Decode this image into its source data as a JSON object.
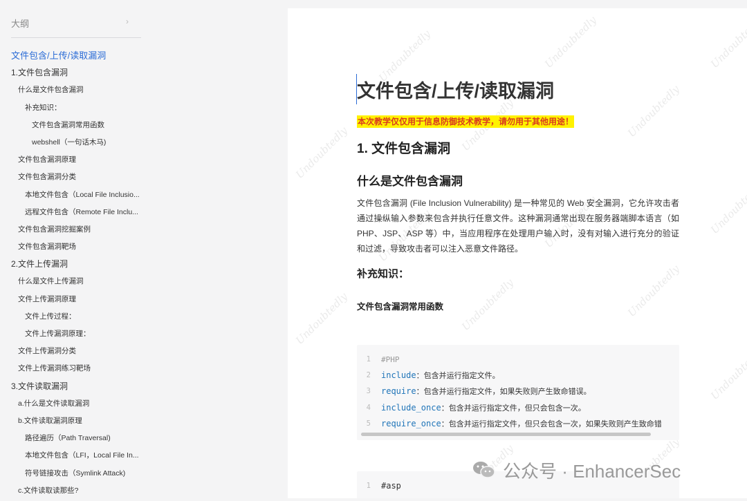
{
  "sidebar": {
    "title": "大纲",
    "collapse_icon": "chevron-right-icon",
    "items": [
      {
        "label": "文件包含/上传/读取漏洞",
        "level": 0
      },
      {
        "label": "1.文件包含漏洞",
        "level": 1
      },
      {
        "label": "什么是文件包含漏洞",
        "level": 2
      },
      {
        "label": "补充知识：",
        "level": 3
      },
      {
        "label": "文件包含漏洞常用函数",
        "level": 4
      },
      {
        "label": "webshell（一句话木马)",
        "level": 4
      },
      {
        "label": "文件包含漏洞原理",
        "level": 2
      },
      {
        "label": "文件包含漏洞分类",
        "level": 2
      },
      {
        "label": "本地文件包含（Local File Inclusio...",
        "level": 3
      },
      {
        "label": "远程文件包含（Remote File Inclu...",
        "level": 3
      },
      {
        "label": "文件包含漏洞挖掘案例",
        "level": 2
      },
      {
        "label": "文件包含漏洞靶场",
        "level": 2
      },
      {
        "label": "2.文件上传漏洞",
        "level": 1
      },
      {
        "label": "什么是文件上传漏洞",
        "level": 2
      },
      {
        "label": "文件上传漏洞原理",
        "level": 2
      },
      {
        "label": "文件上传过程：",
        "level": 3
      },
      {
        "label": "文件上传漏洞原理：",
        "level": 3
      },
      {
        "label": "文件上传漏洞分类",
        "level": 2
      },
      {
        "label": "文件上传漏洞练习靶场",
        "level": 2
      },
      {
        "label": "3.文件读取漏洞",
        "level": 1
      },
      {
        "label": "a.什么是文件读取漏洞",
        "level": 2
      },
      {
        "label": "b.文件读取漏洞原理",
        "level": 2
      },
      {
        "label": "路径遍历（Path Traversal)",
        "level": 3
      },
      {
        "label": "本地文件包含（LFI，Local File In...",
        "level": 3
      },
      {
        "label": "符号链接攻击（Symlink Attack)",
        "level": 3
      },
      {
        "label": "c.文件读取读那些?",
        "level": 2
      }
    ]
  },
  "document": {
    "title": "文件包含/上传/读取漏洞",
    "warning": "本次教学仅仅用于信息防御技术教学，请勿用于其他用途！",
    "h1": "1. 文件包含漏洞",
    "h2": "什么是文件包含漏洞",
    "paragraph": "文件包含漏洞 (File Inclusion Vulnerability) 是一种常见的 Web 安全漏洞，它允许攻击者通过操纵输入参数来包含并执行任意文件。这种漏洞通常出现在服务器端脚本语言（如 PHP、JSP、ASP 等）中，当应用程序在处理用户输入时，没有对输入进行充分的验证和过滤，导致攻击者可以注入恶意文件路径。",
    "h3": "补充知识：",
    "h4": "文件包含漏洞常用函数",
    "code_block_1": [
      {
        "n": "1",
        "comment": "#PHP"
      },
      {
        "n": "2",
        "keyword": "include",
        "desc": "：包含并运行指定文件。"
      },
      {
        "n": "3",
        "keyword": "require",
        "desc": "：包含并运行指定文件，如果失败则产生致命错误。"
      },
      {
        "n": "4",
        "keyword": "include_once",
        "desc": "：包含并运行指定文件，但只会包含一次。"
      },
      {
        "n": "5",
        "keyword": "require_once",
        "desc": "：包含并运行指定文件，但只会包含一次，如果失败则产生致命错"
      }
    ],
    "code_block_2": [
      {
        "n": "1",
        "text": "#asp"
      }
    ],
    "scroll_fraction": 0.9
  },
  "watermark": {
    "text": "Undoubtedly",
    "wechat_text": "公众号 · EnhancerSec",
    "wechat_icon": "wechat-icon"
  },
  "colors": {
    "link_blue": "#2a6bd6",
    "warning_red": "#d93b1f",
    "highlight_yellow": "#fff200",
    "code_keyword": "#1f74b8"
  }
}
